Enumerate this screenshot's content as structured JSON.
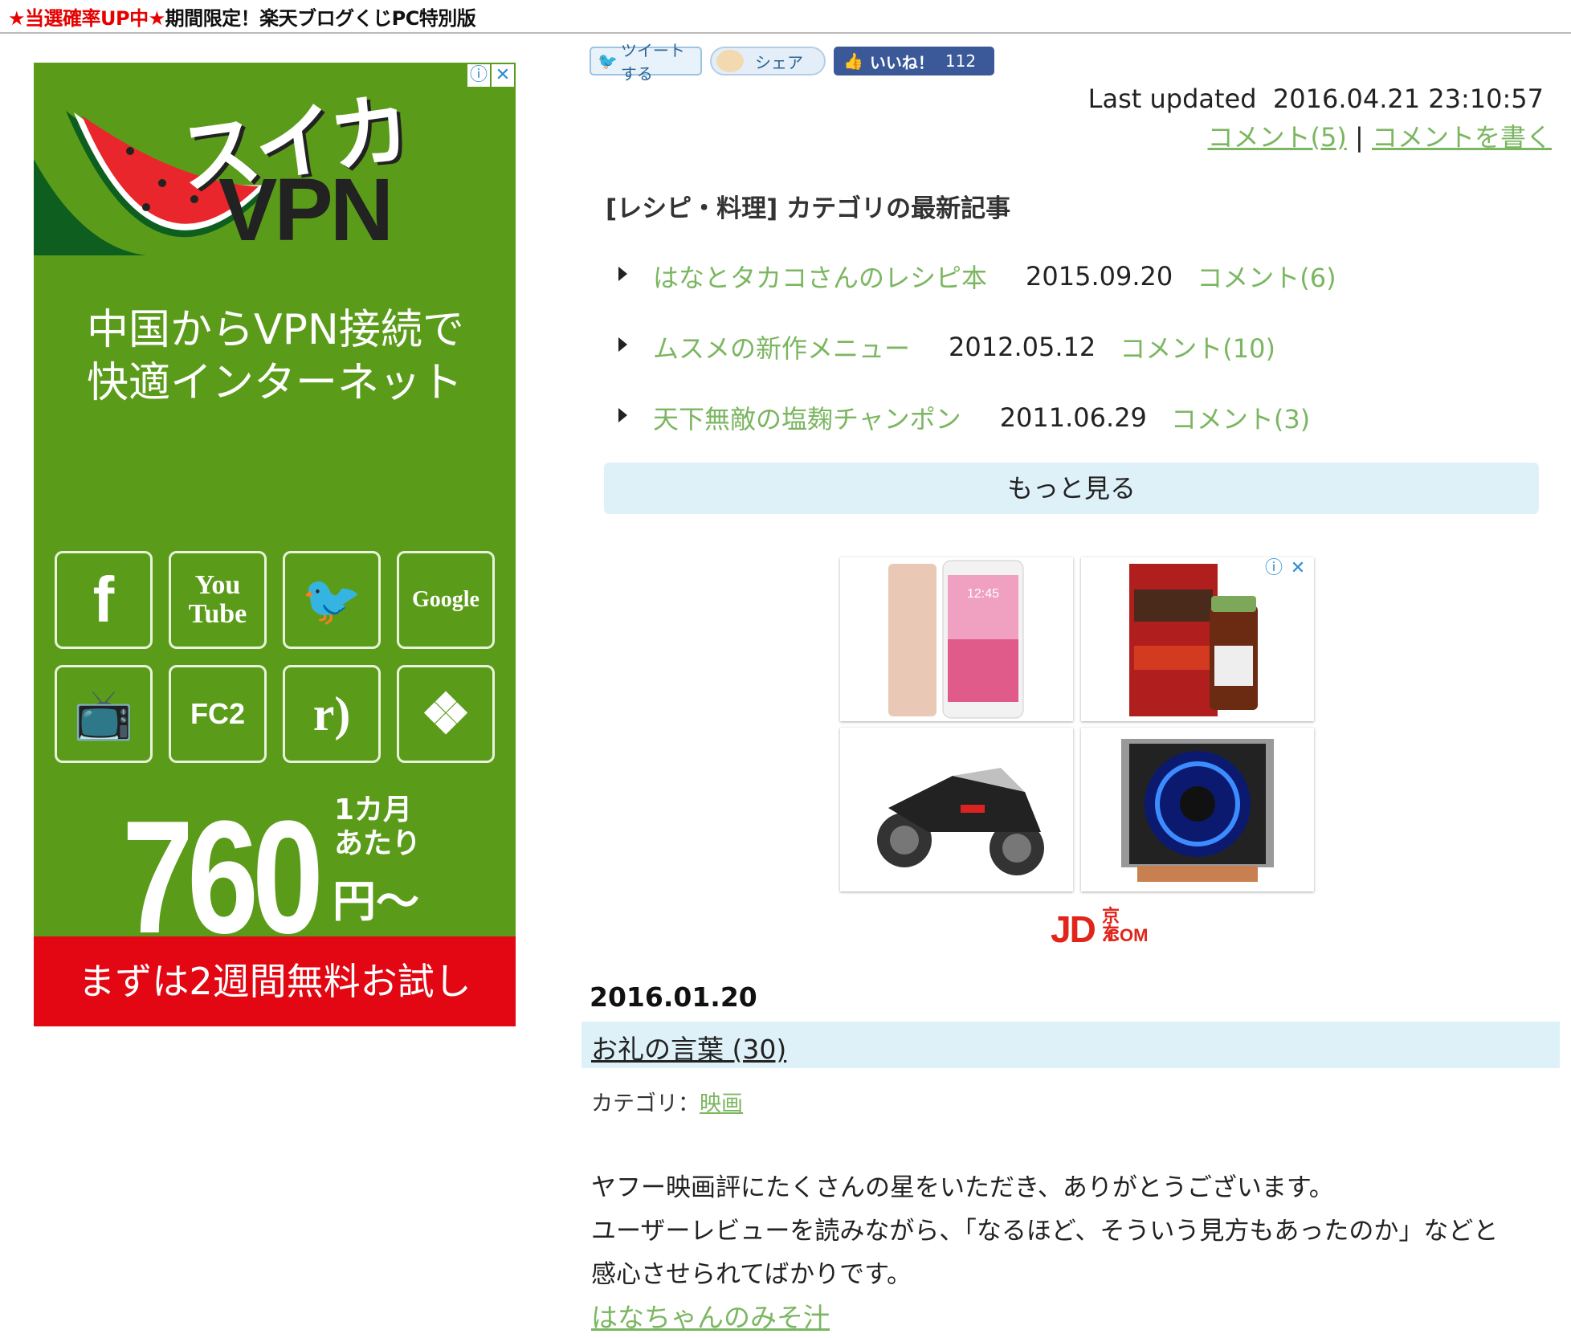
{
  "promo": {
    "red_part": "★当選確率UP中★",
    "black_part": "期間限定！楽天ブログくじPC特別版"
  },
  "ad_left": {
    "brand": "スイカ",
    "product": "VPN",
    "tagline_line1": "中国からVPN接続で",
    "tagline_line2": "快適インターネット",
    "tiles": [
      {
        "icon": "facebook-icon",
        "label": "f"
      },
      {
        "icon": "youtube-icon",
        "label": "You Tube"
      },
      {
        "icon": "twitter-icon",
        "label": "🐦"
      },
      {
        "icon": "google-icon",
        "label": "Google"
      },
      {
        "icon": "niconico-icon",
        "label": "📺"
      },
      {
        "icon": "fc2-icon",
        "label": "FC2"
      },
      {
        "icon": "rakuten-radio-icon",
        "label": "r)"
      },
      {
        "icon": "dropbox-icon",
        "label": "❖"
      }
    ],
    "price": "760",
    "per_line1": "1カ月",
    "per_line2": "あたり",
    "yen": "円〜",
    "cta": "まずは2週間無料お試し",
    "bg_color": "#5a9c1a",
    "cta_color": "#e30613"
  },
  "share": {
    "tweet": "ツイートする",
    "share": "シェア",
    "like": "いいね！",
    "like_count": "112"
  },
  "updated": {
    "label": "Last updated",
    "value": "2016.04.21 23:10:57"
  },
  "comments": {
    "count_link": "コメント(5)",
    "separator": "|",
    "write_link": "コメントを書く"
  },
  "category_section": {
    "title": "[レシピ・料理] カテゴリの最新記事",
    "items": [
      {
        "title": "はなとタカコさんのレシピ本",
        "date": "2015.09.20",
        "comments": "コメント(6)"
      },
      {
        "title": "ムスメの新作メニュー",
        "date": "2012.05.12",
        "comments": "コメント(10)"
      },
      {
        "title": "天下無敵の塩麹チャンポン",
        "date": "2011.06.29",
        "comments": "コメント(3)"
      }
    ],
    "more": "もっと見る"
  },
  "ad_right": {
    "products": [
      "smartphone",
      "nattokinase-supplement",
      "pocket-motorbike",
      "cpu-cooler"
    ],
    "logo_main": "JD",
    "logo_cn": "京东",
    "logo_com": ".COM"
  },
  "post": {
    "date": "2016.01.20",
    "title": "お礼の言葉 (30)",
    "category_label": "カテゴリ：",
    "category": "映画",
    "body_line1": "ヤフー映画評にたくさんの星をいただき、ありがとうございます。",
    "body_line2": "ユーザーレビューを読みながら、「なるほど、そういう見方もあったのか」などと",
    "body_line3": "感心させられてばかりです。",
    "link": "はなちゃんのみそ汁"
  },
  "colors": {
    "link_green": "#7bb661",
    "highlight_blue": "#dff1f8",
    "facebook_blue": "#3b5998"
  }
}
